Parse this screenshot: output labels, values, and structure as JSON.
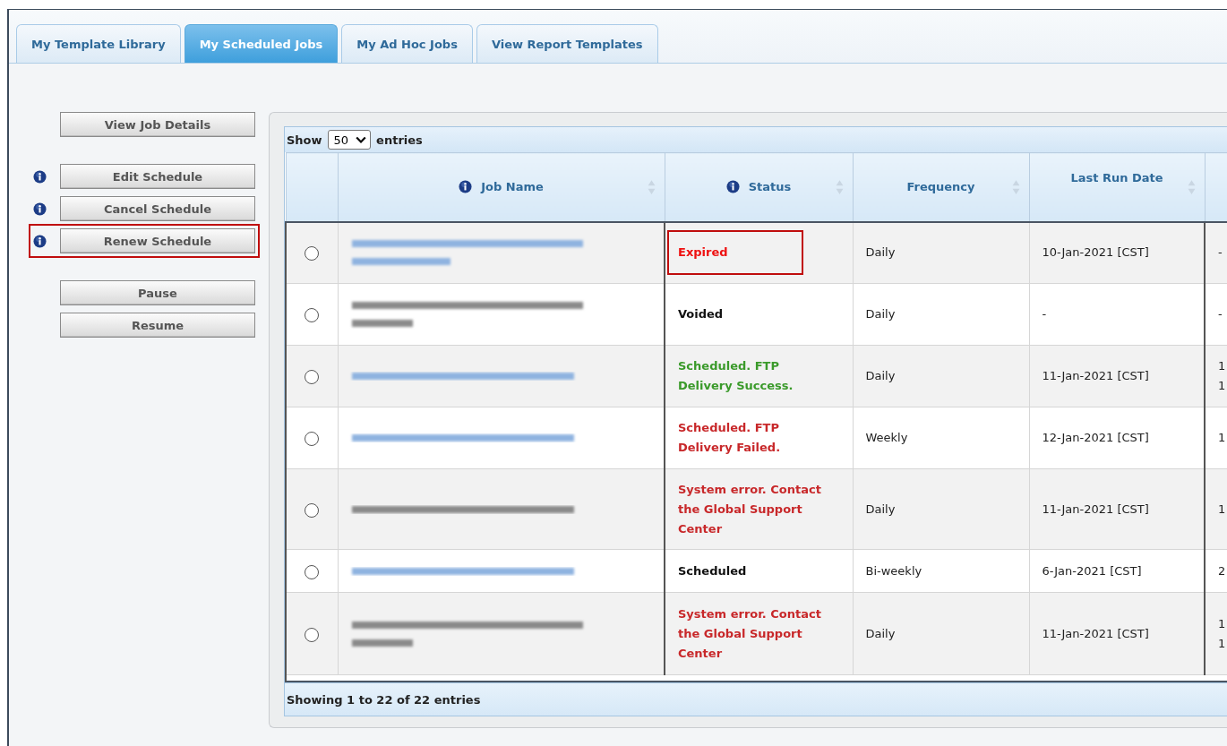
{
  "tabs": [
    {
      "label": "My Template Library",
      "selected": false
    },
    {
      "label": "My Scheduled Jobs",
      "selected": true
    },
    {
      "label": "My Ad Hoc Jobs",
      "selected": false
    },
    {
      "label": "View Report Templates",
      "selected": false
    }
  ],
  "action_groups": [
    [
      {
        "label": "View Job Details",
        "info": false,
        "highlighted": false
      }
    ],
    [
      {
        "label": "Edit Schedule",
        "info": true,
        "highlighted": false
      },
      {
        "label": "Cancel Schedule",
        "info": true,
        "highlighted": false
      },
      {
        "label": "Renew Schedule",
        "info": true,
        "highlighted": true
      }
    ],
    [
      {
        "label": "Pause",
        "info": false,
        "highlighted": false
      },
      {
        "label": "Resume",
        "info": false,
        "highlighted": false
      }
    ]
  ],
  "length_menu": {
    "prefix": "Show",
    "value": "50",
    "suffix": "entries"
  },
  "table": {
    "columns": [
      {
        "label": "Job Name",
        "info": true,
        "sortable": true
      },
      {
        "label": "Status",
        "info": true,
        "sortable": true
      },
      {
        "label": "Frequency",
        "info": false,
        "sortable": true
      },
      {
        "label": "Last Run Date",
        "info": false,
        "sortable": true
      }
    ],
    "rows": [
      {
        "selected": false,
        "job_name": {
          "kind": "link",
          "wrapped": true
        },
        "status": {
          "text": "Expired",
          "color": "#ee1111",
          "boxed": true
        },
        "frequency": "Daily",
        "last_run": "10-Jan-2021 [CST]",
        "column_6": [
          "-"
        ]
      },
      {
        "selected": false,
        "job_name": {
          "kind": "plain",
          "wrapped": true
        },
        "status": {
          "text": "Voided",
          "color": "#111111",
          "boxed": false
        },
        "frequency": "Daily",
        "last_run": "-",
        "column_6": [
          "-"
        ]
      },
      {
        "selected": false,
        "job_name": {
          "kind": "link",
          "wrapped": false
        },
        "status": {
          "text": "Scheduled. FTP Delivery Success.",
          "color": "#3a9a2a",
          "boxed": false
        },
        "frequency": "Daily",
        "last_run": "11-Jan-2021 [CST]",
        "column_6": [
          "1",
          "1"
        ]
      },
      {
        "selected": false,
        "job_name": {
          "kind": "link",
          "wrapped": false
        },
        "status": {
          "text": "Scheduled. FTP Delivery Failed.",
          "color": "#c8282a",
          "boxed": false
        },
        "frequency": "Weekly",
        "last_run": "12-Jan-2021 [CST]",
        "column_6": [
          "1"
        ]
      },
      {
        "selected": false,
        "job_name": {
          "kind": "plain",
          "wrapped": false
        },
        "status": {
          "text": "System error. Contact the Global Support Center",
          "color": "#c8282a",
          "boxed": false
        },
        "frequency": "Daily",
        "last_run": "11-Jan-2021 [CST]",
        "column_6": [
          "1"
        ]
      },
      {
        "selected": false,
        "job_name": {
          "kind": "link",
          "wrapped": false
        },
        "status": {
          "text": "Scheduled",
          "color": "#111111",
          "boxed": false
        },
        "frequency": "Bi-weekly",
        "last_run": "6-Jan-2021 [CST]",
        "column_6": [
          "2"
        ]
      },
      {
        "selected": false,
        "job_name": {
          "kind": "plain",
          "wrapped": true
        },
        "status": {
          "text": "System error. Contact the Global Support Center",
          "color": "#c8282a",
          "boxed": false
        },
        "frequency": "Daily",
        "last_run": "11-Jan-2021 [CST]",
        "column_6": [
          "1",
          "1"
        ]
      }
    ]
  },
  "info_text": "Showing 1 to 22 of 22 entries"
}
